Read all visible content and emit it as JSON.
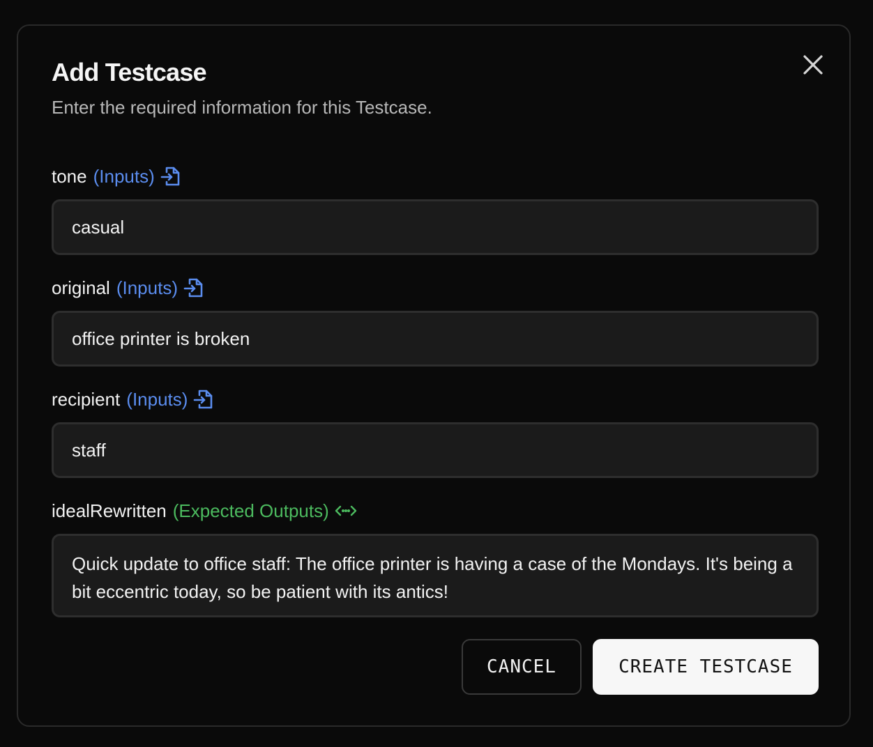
{
  "dialog": {
    "title": "Add Testcase",
    "subtitle": "Enter the required information for this Testcase.",
    "close_icon": "close-icon"
  },
  "fields": [
    {
      "name": "tone",
      "tag": "(Inputs)",
      "icon": "file-import-icon",
      "value": "casual"
    },
    {
      "name": "original",
      "tag": "(Inputs)",
      "icon": "file-import-icon",
      "value": "office printer is broken"
    },
    {
      "name": "recipient",
      "tag": "(Inputs)",
      "icon": "file-import-icon",
      "value": "staff"
    },
    {
      "name": "idealRewritten",
      "tag": "(Expected Outputs)",
      "icon": "code-brackets-icon",
      "value": "Quick update to office staff: The office printer is having a case of the Mondays. It's being a bit eccentric today, so be patient with its antics!"
    }
  ],
  "buttons": {
    "cancel_label": "CANCEL",
    "create_label": "CREATE TESTCASE"
  },
  "colors": {
    "inputs_tag": "#5b8def",
    "outputs_tag": "#4cbb5f",
    "field_background": "#1b1b1b",
    "primary_button": "#f7f7f7"
  }
}
